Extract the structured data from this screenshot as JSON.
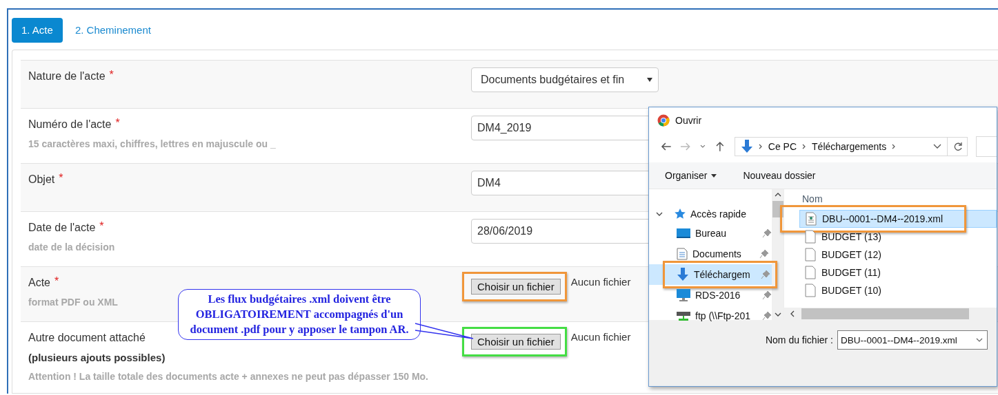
{
  "tabs": [
    {
      "label": "1. Acte",
      "selected": true
    },
    {
      "label": "2. Cheminement",
      "selected": false
    }
  ],
  "fields": [
    {
      "kind": "select",
      "label": "Nature de l'acte",
      "mark": "*",
      "value": "Documents budgétaires et fin"
    },
    {
      "kind": "text",
      "label": "Numéro de l'acte",
      "mark": "*",
      "hint": "15 caractères maxi, chiffres, lettres en majuscule ou _",
      "value": "DM4_2019"
    },
    {
      "kind": "text",
      "label": "Objet",
      "mark": "*",
      "value": "DM4"
    },
    {
      "kind": "text",
      "label": "Date de l'acte",
      "mark": "*",
      "hint": "date de la décision",
      "value": "28/06/2019"
    },
    {
      "kind": "file",
      "label": "Acte",
      "mark": "*",
      "hint": "format PDF ou XML",
      "button": "Choisir un fichier",
      "status": "Aucun fichier",
      "color": "#f0963a"
    },
    {
      "kind": "file",
      "label": "Autre document attaché",
      "note": "(plusieurs ajouts possibles)",
      "hint": "Attention ! La taille totale des documents acte + annexes ne peut pas dépasser 150 Mo.",
      "button": "Choisir un fichier",
      "status": "Aucun fichier",
      "color": "#44dd44"
    }
  ],
  "callout": "Les flux budgétaires .xml doivent être OBLIGATOIREMENT accompagnés d'un document .pdf pour y apposer le tampon AR.",
  "dialog": {
    "title": "Ouvrir",
    "path": [
      "Ce PC",
      "Téléchargements"
    ],
    "toolbar": [
      "Organiser",
      "Nouveau dossier"
    ],
    "nav": {
      "label": "Accès rapide",
      "expanded": true,
      "children": [
        {
          "label": "Bureau",
          "selected": false,
          "highlighted": false
        },
        {
          "label": "Documents",
          "selected": false,
          "highlighted": false
        },
        {
          "label": "Téléchargem",
          "selected": true,
          "highlighted": true
        },
        {
          "label": "RDS-2016",
          "selected": false,
          "highlighted": false
        },
        {
          "label": "ftp (\\\\Ftp-201",
          "selected": false,
          "highlighted": false
        }
      ]
    },
    "column": "Nom",
    "files": [
      {
        "name": "DBU--0001--DM4--2019.xml",
        "selected": true,
        "highlighted": true
      },
      {
        "name": "BUDGET (13)",
        "selected": false,
        "highlighted": false
      },
      {
        "name": "BUDGET (12)",
        "selected": false,
        "highlighted": false
      },
      {
        "name": "BUDGET (11)",
        "selected": false,
        "highlighted": false
      },
      {
        "name": "BUDGET (10)",
        "selected": false,
        "highlighted": false
      }
    ],
    "filename_label": "Nom du fichier :",
    "filename": "DBU--0001--DM4--2019.xml"
  }
}
